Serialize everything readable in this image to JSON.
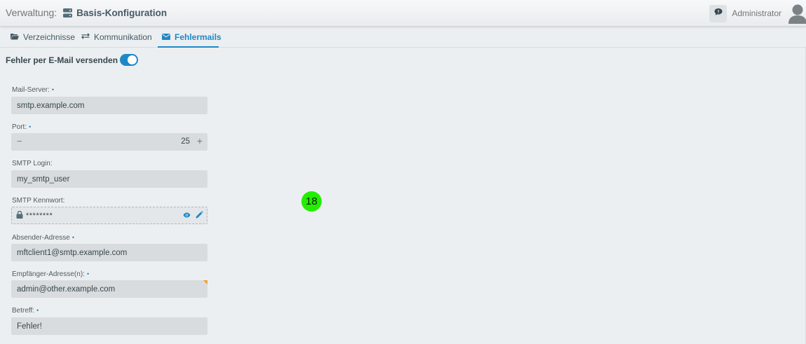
{
  "header": {
    "prefix": "Verwaltung:",
    "title": "Basis-Konfiguration",
    "user": "Administrator"
  },
  "tabs": [
    {
      "label": "Verzeichnisse",
      "icon": "folder-open-icon",
      "active": false
    },
    {
      "label": "Kommunikation",
      "icon": "exchange-icon",
      "active": false
    },
    {
      "label": "Fehlermails",
      "icon": "envelope-icon",
      "active": true
    }
  ],
  "toggle": {
    "label": "Fehler per E-Mail versenden",
    "on": true
  },
  "required_marker": "•",
  "form": {
    "mail_server": {
      "label": "Mail-Server:",
      "value": "smtp.example.com"
    },
    "port": {
      "label": "Port:",
      "value": "25",
      "minus": "−",
      "plus": "+"
    },
    "smtp_login": {
      "label": "SMTP Login:",
      "value": "my_smtp_user"
    },
    "smtp_password": {
      "label": "SMTP Kennwort:",
      "value": "********"
    },
    "sender": {
      "label": "Absender-Adresse",
      "value": "mftclient1@smtp.example.com"
    },
    "recipients": {
      "label": "Empfänger-Adresse(n):",
      "value": "admin@other.example.com"
    },
    "subject": {
      "label": "Betreff:",
      "value": "Fehler!"
    }
  },
  "badge": {
    "value": "18"
  },
  "colors": {
    "accent": "#1e88c7",
    "badge": "#22ee00",
    "background": "#eceff1",
    "field": "#d9dcde"
  }
}
